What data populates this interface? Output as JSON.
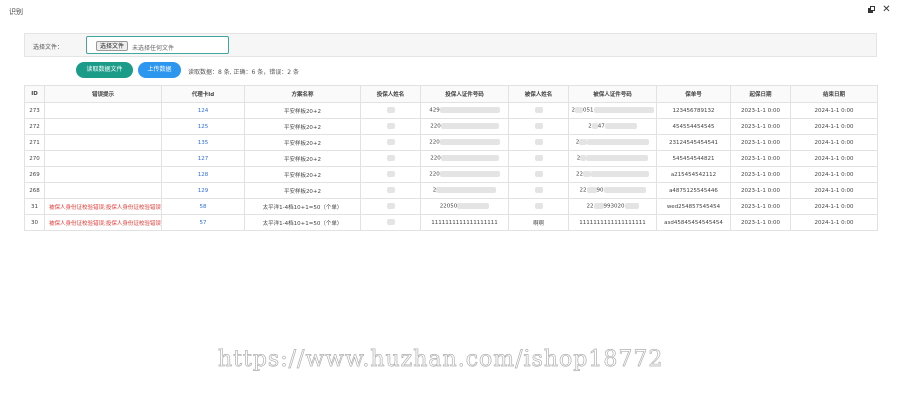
{
  "window": {
    "title": "识别",
    "restore_icon": "restore-icon",
    "close_icon": "close-icon",
    "close_glyph": "✕"
  },
  "file_picker": {
    "label": "选择文件：",
    "button": "选择文件",
    "status": "未选择任何文件"
  },
  "actions": {
    "read_button": "读取数据文件",
    "upload_button": "上传数据"
  },
  "summary": "读取数据：8 条, 正确：6 条，错误：2 条",
  "colors": {
    "teal": "#1a9c88",
    "blue": "#2d96ef",
    "error_red": "#e53935",
    "link_blue": "#2d6fd8"
  },
  "table": {
    "headers": [
      "ID",
      "错误提示",
      "代理卡Id",
      "方案名称",
      "投保人姓名",
      "投保人证件号码",
      "被保人姓名",
      "被保人证件号码",
      "保单号",
      "起保日期",
      "结束日期"
    ],
    "rows": [
      {
        "id": "273",
        "error": "",
        "card": "124",
        "plan": "平安样板20+2",
        "holder": "",
        "holder_id": "429",
        "insured": "",
        "insured_id": "2",
        "insured_id_mid": "051",
        "policy": "123456789132",
        "start": "2023-1-1 0:00",
        "end": "2024-1-1 0:00"
      },
      {
        "id": "272",
        "error": "",
        "card": "125",
        "plan": "平安样板20+2",
        "holder": "",
        "holder_id": "220",
        "insured": "",
        "insured_id": "2",
        "insured_id_mid": "47",
        "policy": "454554454545",
        "start": "2023-1-1 0:00",
        "end": "2024-1-1 0:00"
      },
      {
        "id": "271",
        "error": "",
        "card": "135",
        "plan": "平安样板20+2",
        "holder": "",
        "holder_id": "220",
        "insured": "",
        "insured_id": "2",
        "insured_id_mid": "",
        "policy": "23124545454541",
        "start": "2023-1-1 0:00",
        "end": "2024-1-1 0:00"
      },
      {
        "id": "270",
        "error": "",
        "card": "127",
        "plan": "平安样板20+2",
        "holder": "",
        "holder_id": "220",
        "insured": "",
        "insured_id": "2",
        "insured_id_mid": "",
        "policy": "545454544821",
        "start": "2023-1-1 0:00",
        "end": "2024-1-1 0:00"
      },
      {
        "id": "269",
        "error": "",
        "card": "128",
        "plan": "平安样板20+2",
        "holder": "",
        "holder_id": "220",
        "insured": "",
        "insured_id": "22",
        "insured_id_mid": "",
        "policy": "a215454542112",
        "start": "2023-1-1 0:00",
        "end": "2024-1-1 0:00"
      },
      {
        "id": "268",
        "error": "",
        "card": "129",
        "plan": "平安样板20+2",
        "holder": "",
        "holder_id": "2",
        "insured": "",
        "insured_id": "22",
        "insured_id_mid": "90",
        "policy": "a4875125545446",
        "start": "2023-1-1 0:00",
        "end": "2024-1-1 0:00"
      },
      {
        "id": "31",
        "error": "被保人身份证校验错误;投保人身份证校验错误",
        "card": "58",
        "plan": "太平洋1-4档10+1=50（个单）",
        "holder": "",
        "holder_id": "22050",
        "insured": "",
        "insured_id": "22",
        "insured_id_mid": "993020",
        "policy": "wed254857545454",
        "start": "2023-1-1 0:00",
        "end": "2024-1-1 0:00"
      },
      {
        "id": "30",
        "error": "被保人身份证校验错误;投保人身份证校验错误",
        "card": "57",
        "plan": "太平洋1-4档10+1=50（个单）",
        "holder": "",
        "holder_id": "1111111111111111111",
        "insured": "啊啊",
        "insured_id": "1111111111111111111",
        "insured_id_mid": "",
        "policy": "asd45845454545454",
        "start": "2023-1-1 0:00",
        "end": "2024-1-1 0:00"
      }
    ]
  },
  "watermark": "https://www.huzhan.com/ishop18772"
}
